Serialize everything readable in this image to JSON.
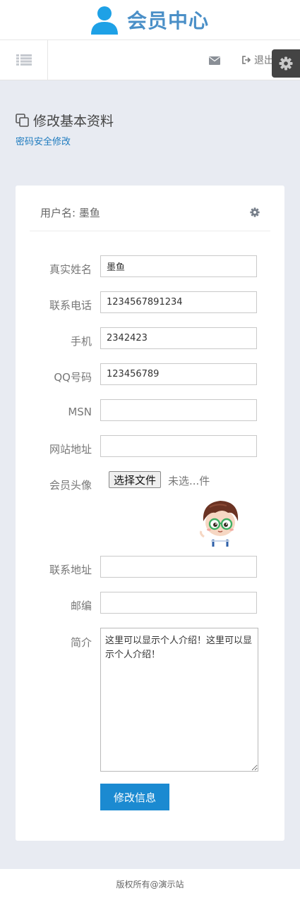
{
  "header": {
    "title": "会员中心",
    "brand_color": "#4a8fc7"
  },
  "navbar": {
    "menu_icon": "list-icon",
    "mail_icon": "envelope-icon",
    "logout_icon": "sign-out-icon",
    "logout_label": "退出",
    "settings_icon": "gear-icon"
  },
  "page": {
    "title": "修改基本资料",
    "subtitle_link": "密码安全修改"
  },
  "card": {
    "title": "用户名: 墨鱼",
    "gear_icon": "gear-icon"
  },
  "form": {
    "real_name": {
      "label": "真实姓名",
      "value": "墨鱼"
    },
    "phone": {
      "label": "联系电话",
      "value": "1234567891234"
    },
    "mobile": {
      "label": "手机",
      "value": "2342423"
    },
    "qq": {
      "label": "QQ号码",
      "value": "123456789"
    },
    "msn": {
      "label": "MSN",
      "value": ""
    },
    "website": {
      "label": "网站地址",
      "value": ""
    },
    "avatar": {
      "label": "会员头像",
      "button": "选择文件",
      "status": "未选...件"
    },
    "address": {
      "label": "联系地址",
      "value": ""
    },
    "zipcode": {
      "label": "邮编",
      "value": ""
    },
    "bio": {
      "label": "简介",
      "value": "这里可以显示个人介绍！这里可以显示个人介绍！"
    },
    "submit_label": "修改信息"
  },
  "footer": {
    "text": "版权所有@演示站"
  },
  "colors": {
    "primary": "#1b8ad1",
    "link": "#1e7bbf",
    "page_bg": "#e8ebf2"
  }
}
